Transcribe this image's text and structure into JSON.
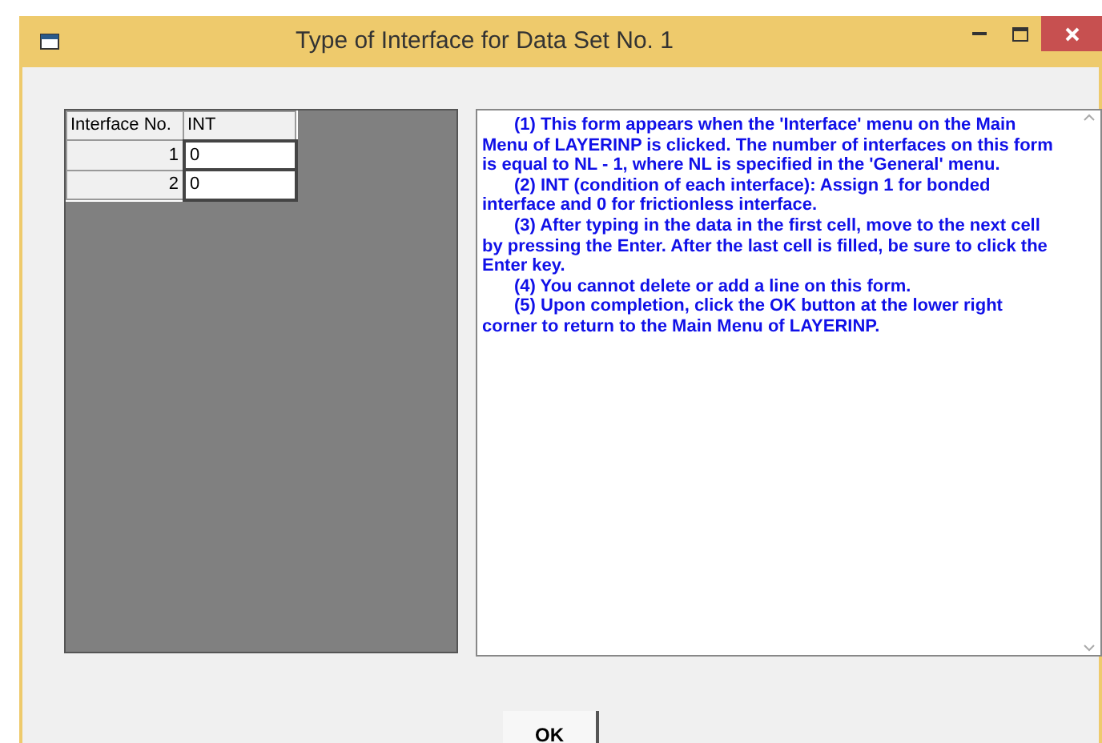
{
  "window": {
    "title": "Type of Interface for Data Set No. 1"
  },
  "table": {
    "columns": [
      "Interface No.",
      "INT"
    ],
    "rows": [
      {
        "cells": [
          "1",
          "0"
        ]
      },
      {
        "cells": [
          "2",
          "0"
        ]
      }
    ]
  },
  "instructions": [
    "(1)  This form appears when the 'Interface' menu on the Main Menu of LAYERINP is clicked.  The number of interfaces on this form is equal to NL - 1, where NL is specified in the 'General' menu.",
    "(2)  INT (condition of each interface): Assign 1 for bonded interface and 0 for frictionless interface.",
    "(3)  After typing in the data in the first cell, move to the next cell by pressing the Enter.  After the last cell is filled, be sure to click the Enter key.",
    "(4)  You cannot delete or add a line on this form.",
    "(5)  Upon completion, click the OK button at the lower right corner to return to the Main Menu of LAYERINP."
  ],
  "buttons": [
    "OK"
  ]
}
